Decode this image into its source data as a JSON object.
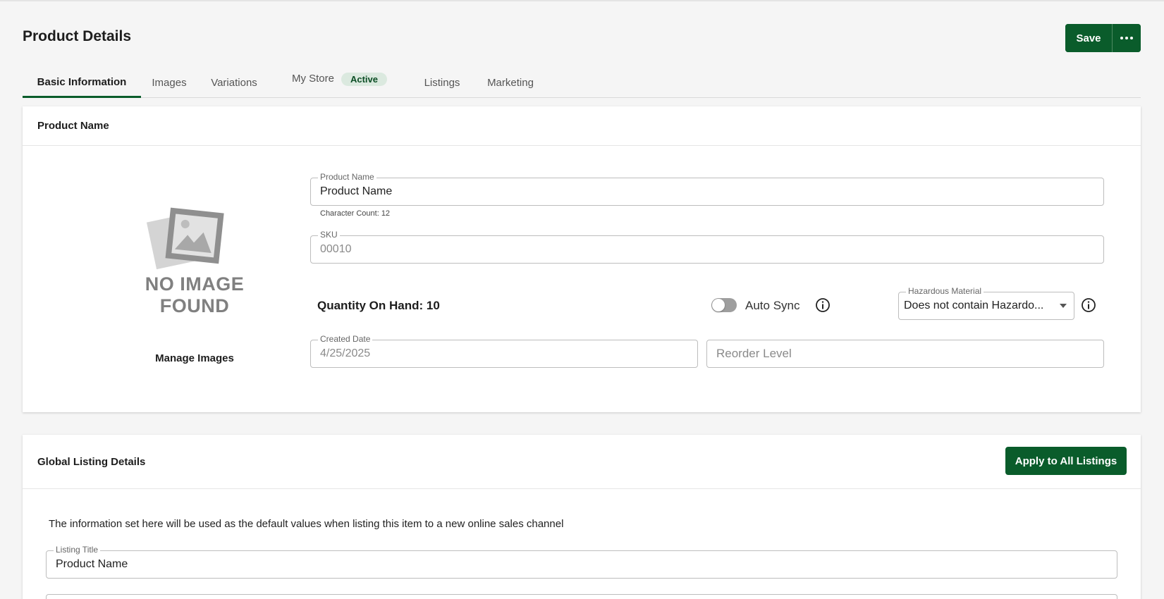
{
  "header": {
    "title": "Product Details",
    "save_label": "Save",
    "more_icon": "ellipsis-horizontal-icon"
  },
  "tabs": [
    {
      "label": "Basic Information",
      "active": true
    },
    {
      "label": "Images"
    },
    {
      "label": "Variations"
    },
    {
      "label": "My Store",
      "badge": "Active"
    },
    {
      "label": "Listings"
    },
    {
      "label": "Marketing"
    }
  ],
  "product_card": {
    "title": "Product Name",
    "image": {
      "icon": "image-placeholder-icon",
      "text_line1": "NO IMAGE",
      "text_line2": "FOUND"
    },
    "manage_images_label": "Manage Images",
    "product_name": {
      "label": "Product Name",
      "value": "Product Name",
      "helper": "Character Count: 12"
    },
    "sku": {
      "label": "SKU",
      "value": "00010"
    },
    "quantity_on_hand": "Quantity On Hand: 10",
    "auto_sync": {
      "label": "Auto Sync",
      "enabled": false
    },
    "hazardous_material": {
      "label": "Hazardous Material",
      "value": "Does not contain Hazardo..."
    },
    "created_date": {
      "label": "Created Date",
      "value": "4/25/2025"
    },
    "reorder_level": {
      "placeholder": "Reorder Level"
    }
  },
  "global_listing_card": {
    "title": "Global Listing Details",
    "apply_label": "Apply to All Listings",
    "description": "The information set here will be used as the default values when listing this item to a new online sales channel",
    "listing_title": {
      "label": "Listing Title",
      "value": "Product Name"
    }
  },
  "colors": {
    "primary": "#0a5c2b",
    "badge_bg": "#dbe9df",
    "page_bg": "#f5f5f5"
  }
}
